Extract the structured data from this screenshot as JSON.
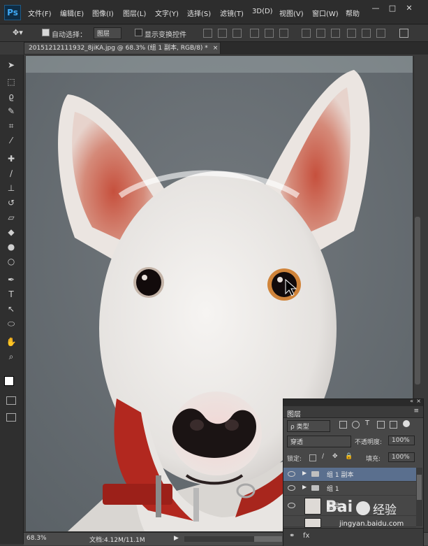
{
  "menubar": {
    "logo": "Ps",
    "items": [
      "文件(F)",
      "编辑(E)",
      "图像(I)",
      "图层(L)",
      "文字(Y)",
      "选择(S)",
      "滤镜(T)",
      "3D(D)",
      "视图(V)",
      "窗口(W)",
      "帮助"
    ],
    "window_buttons": [
      "—",
      "□",
      "✕"
    ]
  },
  "options": {
    "auto_select_label": "自动选择：",
    "auto_select_value": "图层",
    "show_transform_label": "显示变换控件"
  },
  "document": {
    "tab_title": "20151212111932_8jiKA.jpg @ 68.3% (组 1 副本, RGB/8) *",
    "close_glyph": "×"
  },
  "status": {
    "zoom": "68.3%",
    "doc_size": "文档:4.12M/11.1M"
  },
  "layers_panel": {
    "title": "图层",
    "filter_kind": "ρ 类型",
    "blend_mode": "穿透",
    "opacity_label": "不透明度:",
    "opacity_value": "100%",
    "lock_label": "锁定:",
    "fill_label": "填充:",
    "fill_value": "100%",
    "layers": [
      {
        "name": "组 1 副本",
        "type": "group",
        "selected": true
      },
      {
        "name": "组 1",
        "type": "group",
        "selected": false
      },
      {
        "name": "图层 1",
        "type": "layer",
        "selected": false
      }
    ]
  },
  "watermark": {
    "brand": "Bai",
    "brand_suffix": "经验",
    "url": "jingyan.baidu.com"
  },
  "colors": {
    "accent": "#3fa9f5",
    "selected_row": "#5a6f8e",
    "collar": "#b2281f"
  },
  "icons": [
    "move-tool-icon",
    "marquee-tool-icon",
    "lasso-tool-icon",
    "quick-select-icon",
    "crop-tool-icon",
    "eyedropper-icon",
    "healing-brush-icon",
    "brush-tool-icon",
    "clone-stamp-icon",
    "history-brush-icon",
    "eraser-icon",
    "paint-bucket-icon",
    "blur-tool-icon",
    "dodge-tool-icon",
    "pen-tool-icon",
    "type-tool-icon",
    "path-select-icon",
    "shape-tool-icon",
    "hand-tool-icon",
    "zoom-tool-icon"
  ]
}
